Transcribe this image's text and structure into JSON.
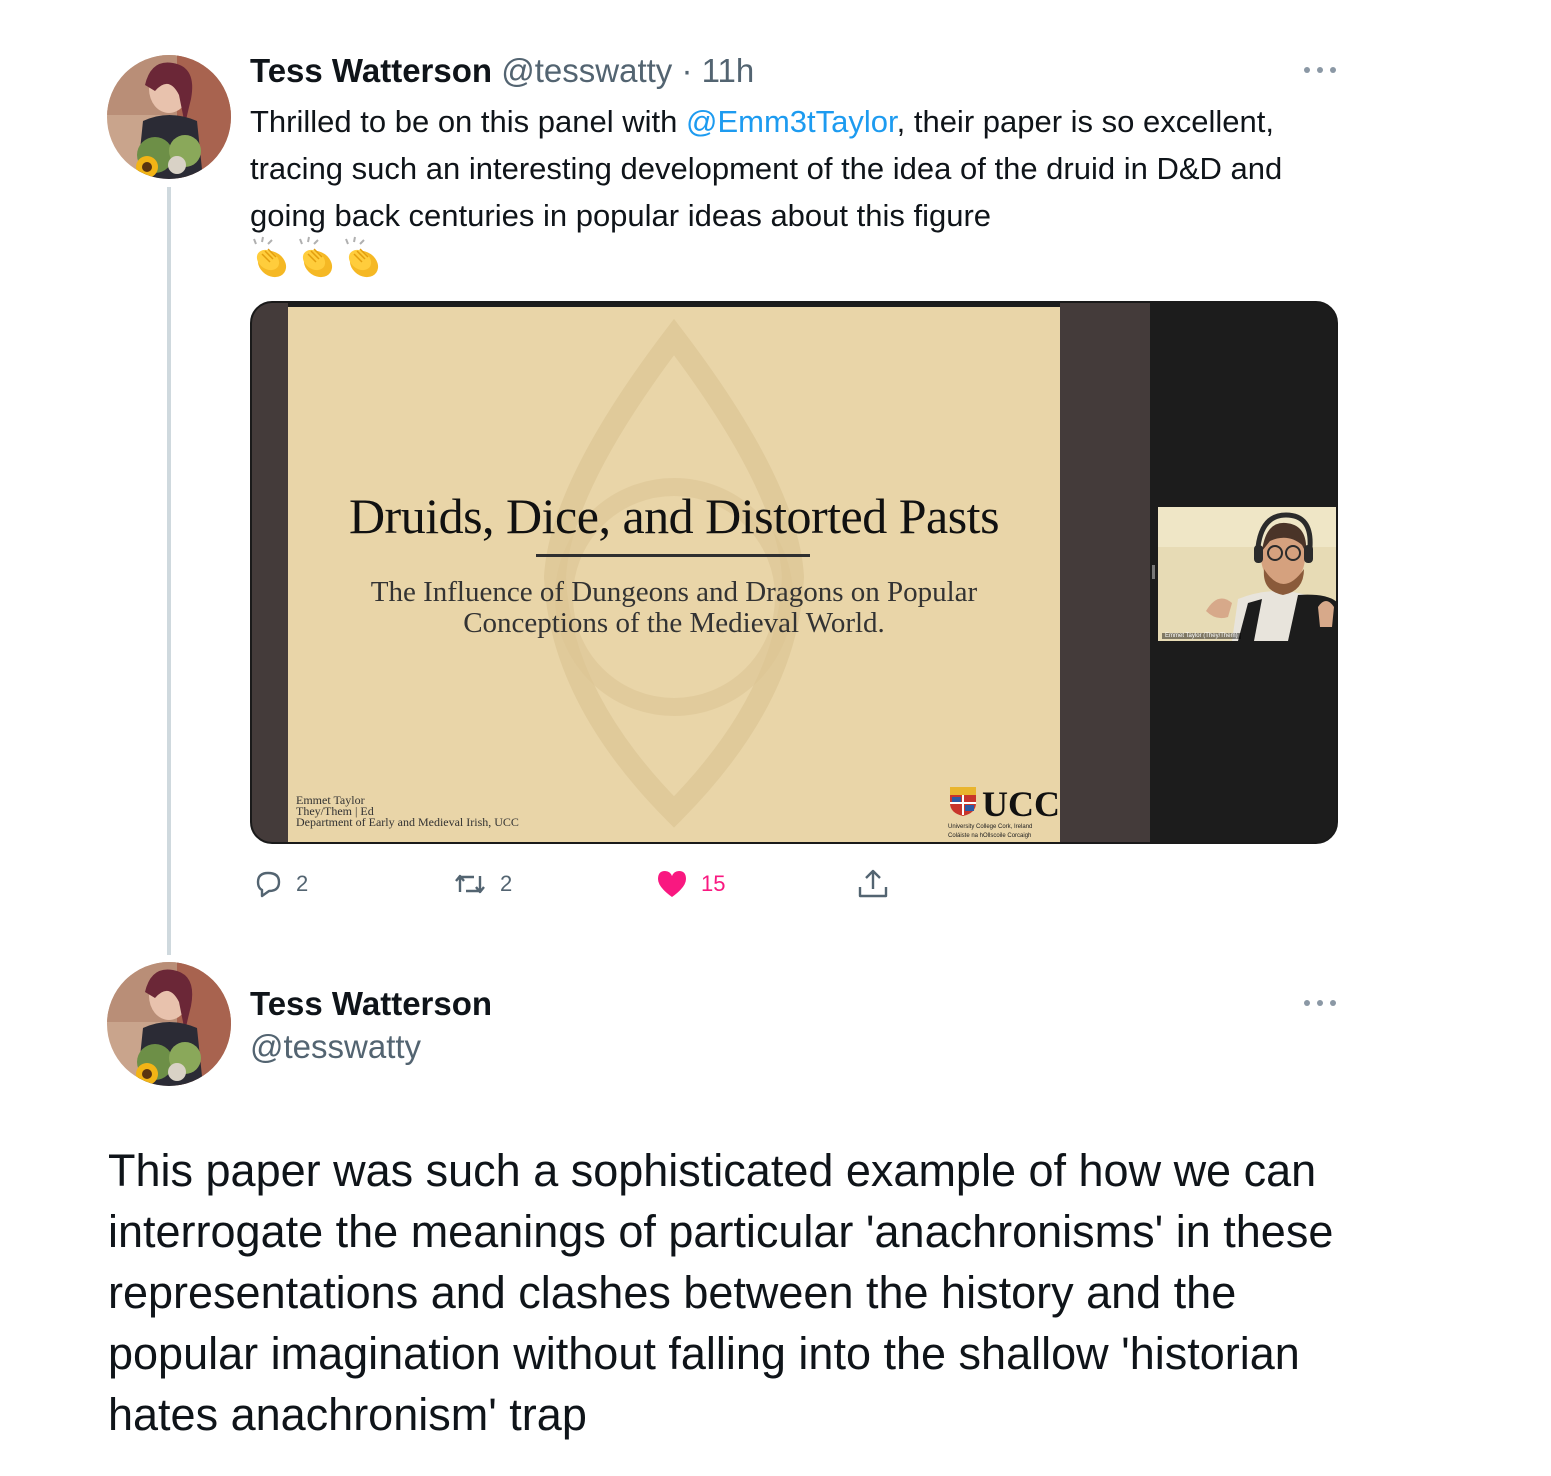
{
  "tweet1": {
    "author_name": "Tess Watterson",
    "handle": "@tesswatty",
    "separator": "·",
    "time": "11h",
    "text_before_mention": "Thrilled to be on this panel with ",
    "mention": "@Emm3tTaylor",
    "text_after_mention": ", their paper is so excellent, tracing such an interesting development of the idea of the druid in D&D and going back centuries in popular ideas about this figure",
    "emoji": [
      "clapping-hands",
      "clapping-hands",
      "clapping-hands"
    ],
    "media": {
      "slide_title": "Druids, Dice, and Distorted Pasts",
      "slide_subtitle": "The Influence of Dungeons and Dragons on Popular Conceptions of the Medieval World.",
      "footer_line1": "Emmet Taylor",
      "footer_line2": "They/Them | Ed",
      "footer_line3": "Department of Early and Medieval Irish, UCC",
      "logo_text": "UCC",
      "logo_sub1": "University College Cork, Ireland",
      "logo_sub2": "Coláiste na hOllscoile Corcaigh",
      "video_participant_label": "Emmet Taylor (They/Them)"
    },
    "actions": {
      "replies": "2",
      "retweets": "2",
      "likes": "15"
    }
  },
  "tweet2": {
    "author_name": "Tess Watterson",
    "handle": "@tesswatty",
    "text": "This paper was such a sophisticated example of how we can interrogate the meanings of particular 'anachronisms' in these representations and clashes between the history and the popular imagination without falling into the shallow 'historian hates anachronism' trap"
  },
  "colors": {
    "accent": "#1d9bf0",
    "like": "#f91880",
    "secondary_text": "#536471",
    "thread_line": "#cfd9de"
  }
}
